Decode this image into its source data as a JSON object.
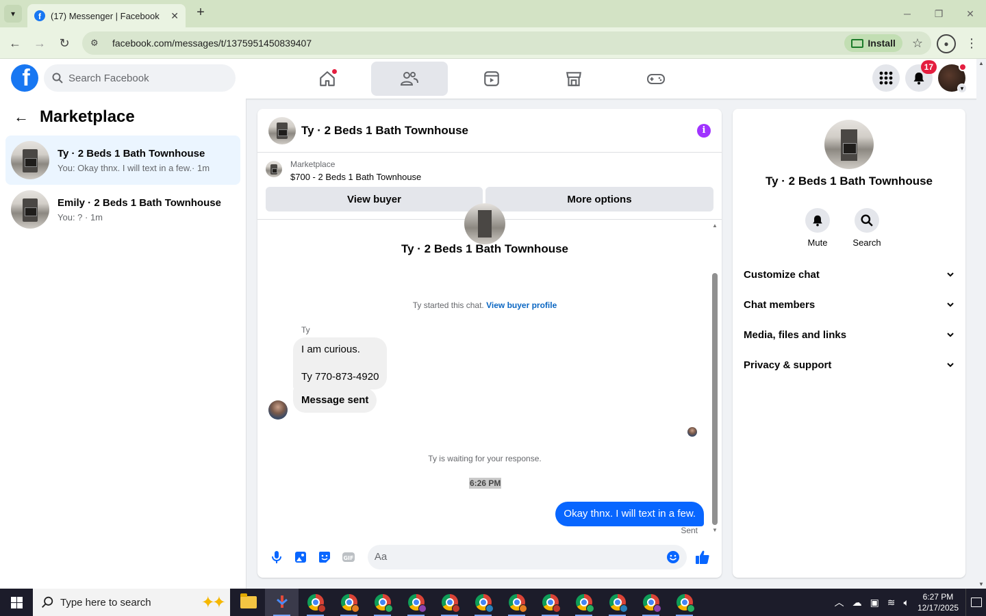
{
  "browser": {
    "tab_title": "(17) Messenger | Facebook",
    "url": "facebook.com/messages/t/1375951450839407",
    "install_label": "Install"
  },
  "fb_header": {
    "search_placeholder": "Search Facebook",
    "notification_count": "17"
  },
  "left_panel": {
    "title": "Marketplace",
    "conversations": [
      {
        "name": "Ty · 2 Beds 1 Bath Townhouse",
        "snippet": "You: Okay thnx. I will text in a few.· 1m",
        "active": true
      },
      {
        "name": "Emily · 2 Beds 1 Bath Townhouse",
        "snippet": "You: ? · 1m",
        "active": false
      }
    ]
  },
  "chat": {
    "title": "Ty · 2 Beds 1 Bath Townhouse",
    "marketplace_label": "Marketplace",
    "listing": "$700 - 2 Beds 1 Bath Townhouse",
    "view_buyer_label": "View buyer",
    "more_options_label": "More options",
    "profile_name": "Ty · 2 Beds 1 Bath Townhouse",
    "started_text": "Ty started this chat.",
    "view_buyer_profile": "View buyer profile",
    "sender_name": "Ty",
    "incoming_line1": "I am curious.",
    "incoming_line2": "Ty 770-873-4920",
    "incoming_2": "Message sent",
    "waiting_text": "Ty is waiting for your response.",
    "timestamp": "6:26 PM",
    "outgoing": "Okay thnx. I will text in a few.",
    "sent_label": "Sent",
    "input_placeholder": "Aa"
  },
  "right_panel": {
    "name": "Ty · 2 Beds 1 Bath Townhouse",
    "mute_label": "Mute",
    "search_label": "Search",
    "sections": [
      "Customize chat",
      "Chat members",
      "Media, files and links",
      "Privacy & support"
    ]
  },
  "taskbar": {
    "search_placeholder": "Type here to search",
    "time": "6:27 PM",
    "date": "12/17/2025",
    "chrome_profile_colors": [
      "#c0392b",
      "#e67e22",
      "#27ae60",
      "#8e44ad",
      "#c0392b",
      "#2980b9",
      "#e67e22",
      "#c0392b",
      "#27ae60",
      "#2980b9",
      "#8e44ad",
      "#27ae60"
    ]
  },
  "colors": {
    "brand_blue": "#1877f2",
    "messenger_blue": "#0866ff",
    "badge_red": "#e41e3f",
    "info_purple": "#a033ff"
  }
}
